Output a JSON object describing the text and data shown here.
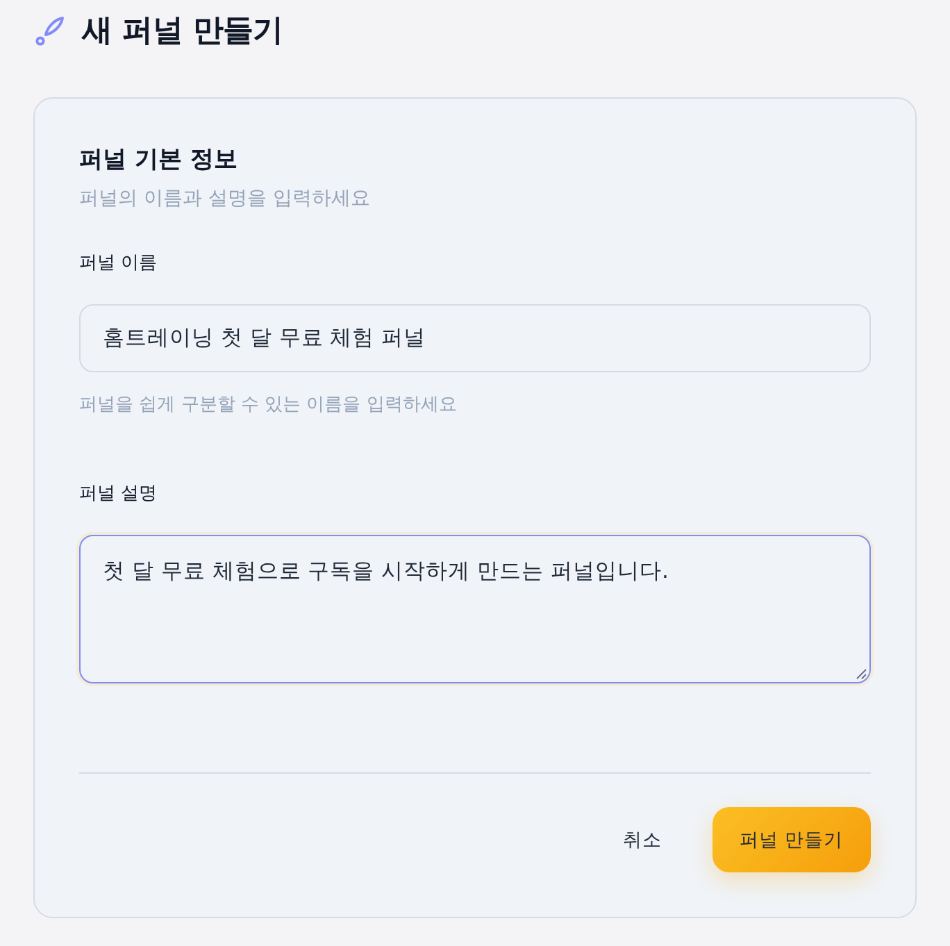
{
  "header": {
    "title": "새 퍼널 만들기"
  },
  "section": {
    "title": "퍼널 기본 정보",
    "subtitle": "퍼널의 이름과 설명을 입력하세요"
  },
  "fields": [
    {
      "kind": "input",
      "label": "퍼널 이름",
      "value": "홈트레이닝 첫 달 무료 체험 퍼널",
      "hint": "퍼널을 쉽게 구분할 수 있는 이름을 입력하세요",
      "focused": false
    },
    {
      "kind": "textarea",
      "label": "퍼널 설명",
      "value": "첫 달 무료 체험으로 구독을 시작하게 만드는 퍼널입니다.",
      "focused": true
    }
  ],
  "buttons": [
    {
      "kind": "secondary",
      "label": "취소"
    },
    {
      "kind": "primary",
      "label": "퍼널 만들기"
    }
  ]
}
